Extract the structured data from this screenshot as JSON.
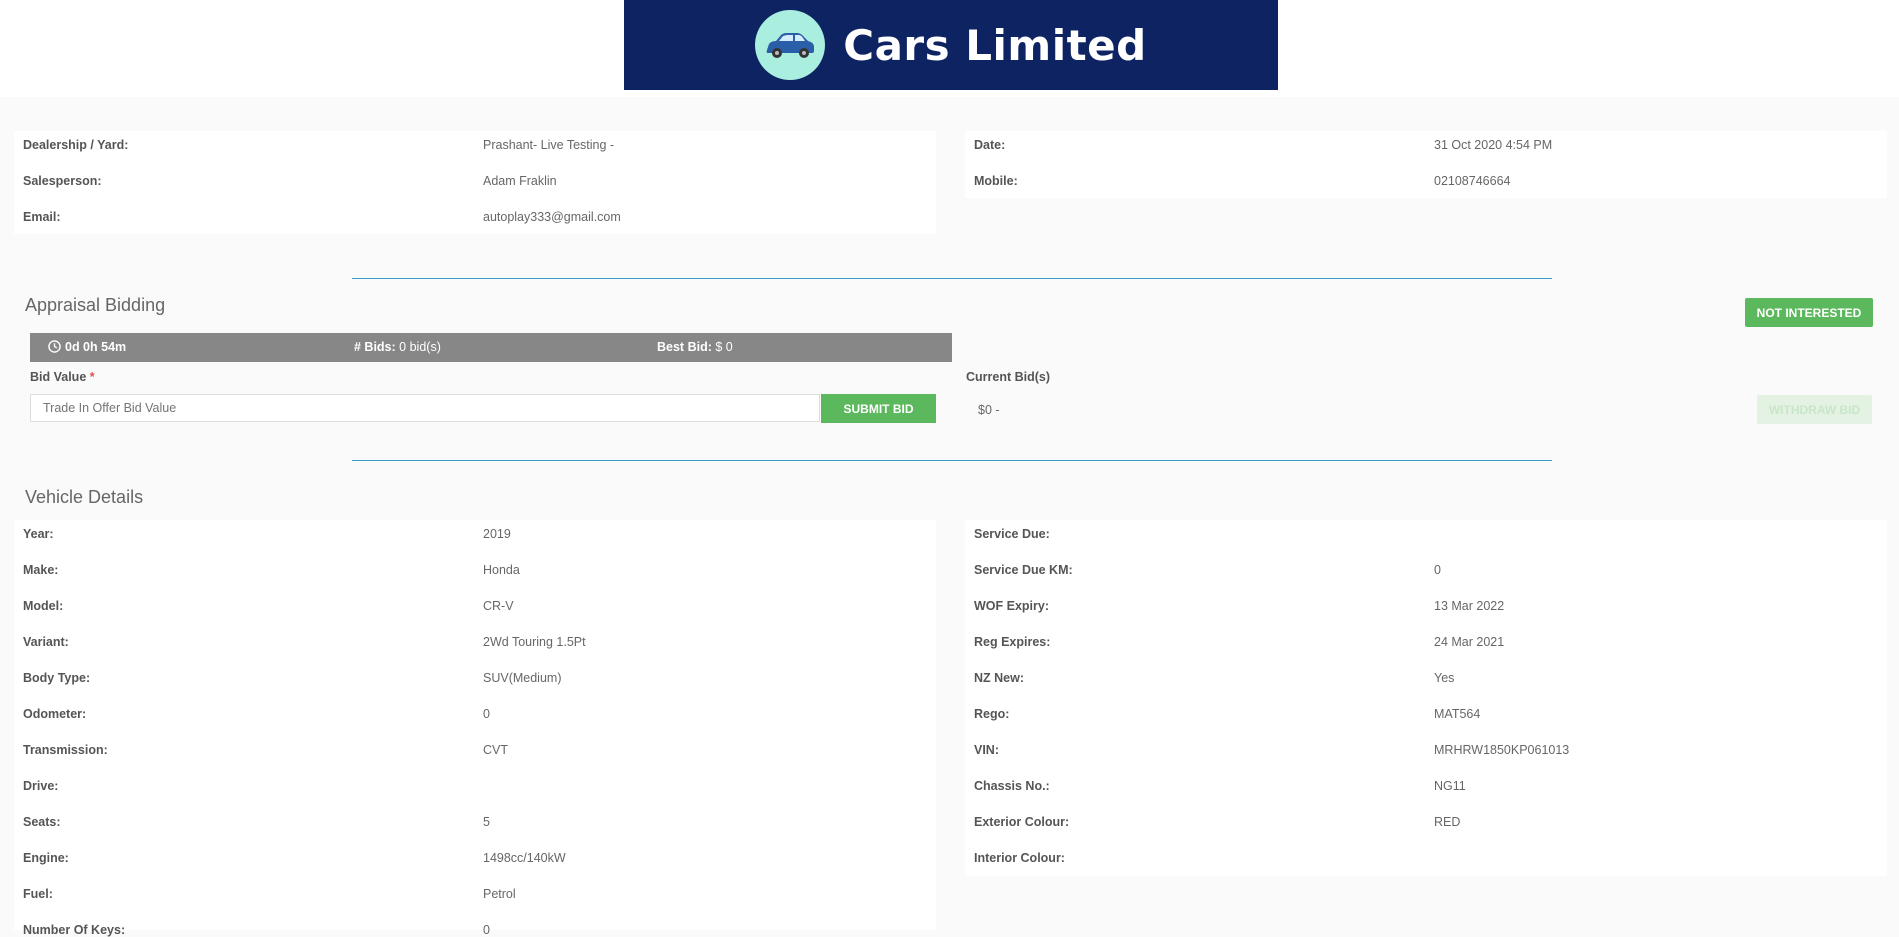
{
  "brand": {
    "title": "Cars Limited",
    "logo_icon": "car-icon"
  },
  "info": {
    "left": [
      {
        "label": "Dealership / Yard:",
        "value": "Prashant- Live Testing -"
      },
      {
        "label": "Salesperson:",
        "value": "Adam Fraklin"
      },
      {
        "label": "Email:",
        "value": "autoplay333@gmail.com"
      }
    ],
    "right": [
      {
        "label": "Date:",
        "value": "31 Oct 2020 4:54 PM"
      },
      {
        "label": "Mobile:",
        "value": "02108746664"
      }
    ]
  },
  "bidding": {
    "title": "Appraisal Bidding",
    "not_interested": "NOT INTERESTED",
    "timer": "0d 0h 54m",
    "bids_label": "# Bids:",
    "bids_value": "0 bid(s)",
    "best_label": "Best Bid:",
    "best_value": "$ 0",
    "bid_value_label": "Bid Value",
    "required_mark": "*",
    "placeholder": "Trade In Offer Bid Value",
    "submit": "SUBMIT BID",
    "current_label": "Current Bid(s)",
    "current_value": "$0 -",
    "withdraw": "WITHDRAW BID"
  },
  "vehicle": {
    "title": "Vehicle Details",
    "left": [
      {
        "label": "Year:",
        "value": "2019"
      },
      {
        "label": "Make:",
        "value": "Honda"
      },
      {
        "label": "Model:",
        "value": "CR-V"
      },
      {
        "label": "Variant:",
        "value": "2Wd Touring 1.5Pt"
      },
      {
        "label": "Body Type:",
        "value": "SUV(Medium)"
      },
      {
        "label": "Odometer:",
        "value": "0"
      },
      {
        "label": "Transmission:",
        "value": "CVT"
      },
      {
        "label": "Drive:",
        "value": ""
      },
      {
        "label": "Seats:",
        "value": "5"
      },
      {
        "label": "Engine:",
        "value": "1498cc/140kW"
      },
      {
        "label": "Fuel:",
        "value": "Petrol"
      },
      {
        "label": "Number Of Keys:",
        "value": "0"
      }
    ],
    "right": [
      {
        "label": "Service Due:",
        "value": ""
      },
      {
        "label": "Service Due KM:",
        "value": "0"
      },
      {
        "label": "WOF Expiry:",
        "value": "13 Mar 2022"
      },
      {
        "label": "Reg Expires:",
        "value": "24 Mar 2021"
      },
      {
        "label": "NZ New:",
        "value": "Yes"
      },
      {
        "label": "Rego:",
        "value": "MAT564"
      },
      {
        "label": "VIN:",
        "value": "MRHRW1850KP061013"
      },
      {
        "label": "Chassis No.:",
        "value": "NG11"
      },
      {
        "label": "Exterior Colour:",
        "value": "RED"
      },
      {
        "label": "Interior Colour:",
        "value": ""
      }
    ]
  },
  "colors": {
    "banner": "#0e2362",
    "logo_bg": "#a9eede",
    "accent_green": "#5cb85c",
    "divider": "#3a9bc7",
    "bidbar": "#878787"
  }
}
